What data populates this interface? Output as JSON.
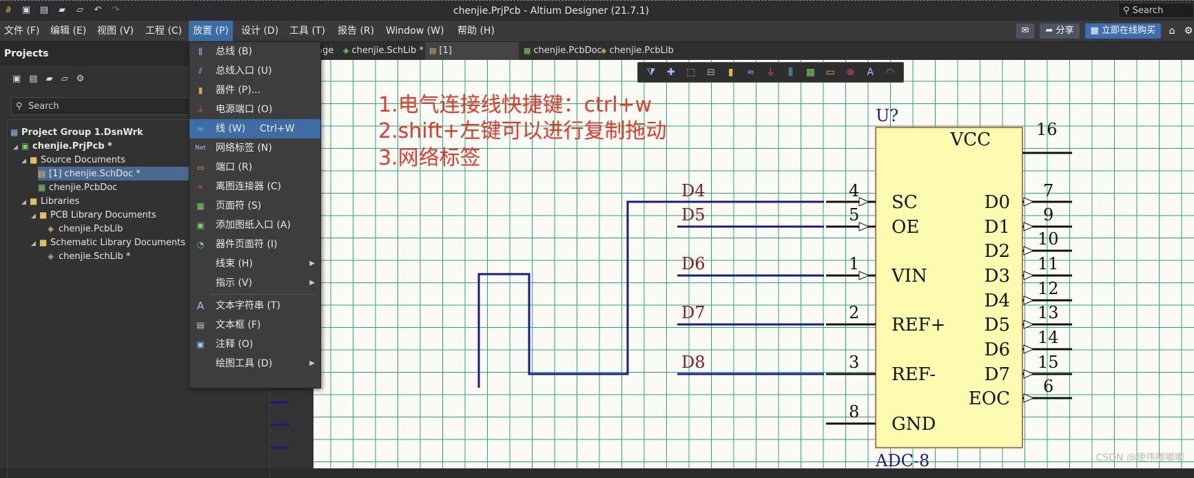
{
  "window": {
    "title": "chenjie.PrjPcb - Altium Designer (21.7.1)",
    "search_label": "Search"
  },
  "menubar": {
    "items": [
      "文件 (F)",
      "编辑 (E)",
      "视图 (V)",
      "工程 (C)",
      "放置 (P)",
      "设计 (D)",
      "工具 (T)",
      "报告 (R)",
      "Window (W)",
      "帮助 (H)"
    ],
    "share_label": "分享",
    "buy_label": "立即在线购买"
  },
  "projects_panel": {
    "title": "Projects",
    "search_placeholder": "Search",
    "tree": [
      {
        "label": "Project Group 1.DsnWrk",
        "level": 0
      },
      {
        "label": "chenjie.PrjPcb *",
        "level": 0
      },
      {
        "label": "Source Documents",
        "level": 1
      },
      {
        "label": "[1] chenjie.SchDoc *",
        "level": 2
      },
      {
        "label": "chenjie.PcbDoc",
        "level": 2
      },
      {
        "label": "Libraries",
        "level": 1
      },
      {
        "label": "PCB Library Documents",
        "level": 2
      },
      {
        "label": "chenjie.PcbLib",
        "level": 3
      },
      {
        "label": "Schematic Library Documents",
        "level": 2
      },
      {
        "label": "chenjie.SchLib *",
        "level": 3
      }
    ]
  },
  "doc_tabs": [
    "age",
    "chenjie.SchLib *",
    "[1] chenjie.SchDoc *",
    "chenjie.PcbDoc",
    "chenjie.PcbLib"
  ],
  "place_menu": {
    "items": [
      {
        "label": "总线 (B)"
      },
      {
        "label": "总线入口 (U)"
      },
      {
        "label": "器件 (P)..."
      },
      {
        "label": "电源端口 (O)"
      },
      {
        "label": "线 (W)",
        "shortcut": "Ctrl+W"
      },
      {
        "label": "网络标签 (N)"
      },
      {
        "label": "端口 (R)"
      },
      {
        "label": "离图连接器 (C)"
      },
      {
        "label": "页面符 (S)"
      },
      {
        "label": "添加图纸入口 (A)"
      },
      {
        "label": "器件页面符 (I)"
      },
      {
        "label": "线束 (H)"
      },
      {
        "label": "指示 (V)"
      },
      {
        "label": "文本字符串 (T)"
      },
      {
        "label": "文本框 (F)"
      },
      {
        "label": "注释 (O)"
      },
      {
        "label": "绘图工具 (D)"
      }
    ]
  },
  "notes": [
    "1.电气连接线快捷键：ctrl+w",
    "2.shift+左键可以进行复制拖动",
    "3.网络标签"
  ],
  "schematic": {
    "designator": "U?",
    "part_name": "ADC-8",
    "vcc_pin": {
      "name": "VCC",
      "number": "16"
    },
    "left_pins": [
      {
        "name": "SC",
        "number": "4",
        "net": "D4"
      },
      {
        "name": "OE",
        "number": "5",
        "net": "D5"
      },
      {
        "name": "VIN",
        "number": "1",
        "net": "D6"
      },
      {
        "name": "REF+",
        "number": "2",
        "net": "D7"
      },
      {
        "name": "REF-",
        "number": "3",
        "net": "D8"
      },
      {
        "name": "GND",
        "number": "8",
        "net": ""
      }
    ],
    "right_pins": [
      {
        "name": "D0",
        "number": "7"
      },
      {
        "name": "D1",
        "number": "9"
      },
      {
        "name": "D2",
        "number": "10"
      },
      {
        "name": "D3",
        "number": "11"
      },
      {
        "name": "D4",
        "number": "12"
      },
      {
        "name": "D5",
        "number": "13"
      },
      {
        "name": "D6",
        "number": "14"
      },
      {
        "name": "D7",
        "number": "15"
      },
      {
        "name": "EOC",
        "number": "6"
      }
    ]
  },
  "watermark": "CSDN @使伟嘟嘟嘟",
  "colors": {
    "wire": "#1a1a8a",
    "net_label": "#8b1a1a",
    "component_fill": "#fdfbb0",
    "component_border": "#c04030",
    "note_red": "#e23a2a"
  }
}
